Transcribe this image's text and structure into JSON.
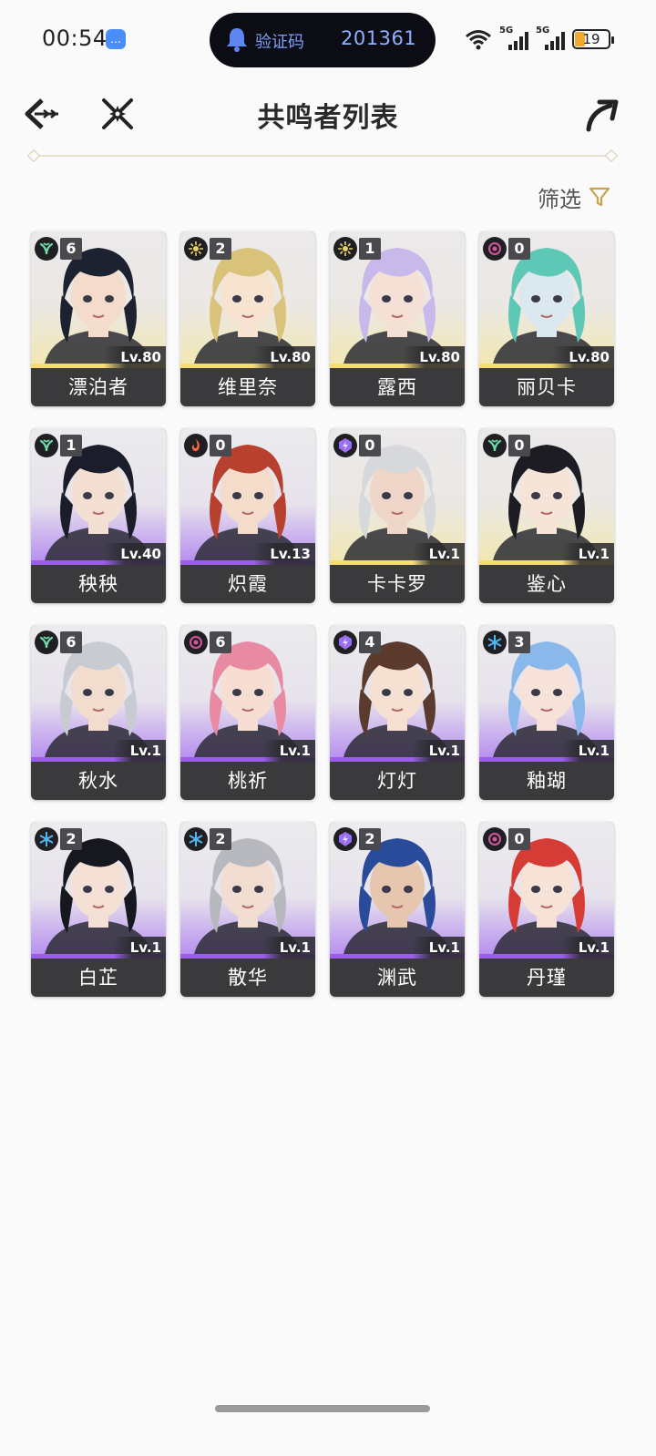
{
  "status_bar": {
    "time": "00:54",
    "pill_label": "验证码",
    "pill_code": "201361",
    "network_1": "5G",
    "network_2": "5G",
    "battery": "19"
  },
  "header": {
    "title": "共鸣者列表"
  },
  "filter": {
    "label": "筛选"
  },
  "colors": {
    "accent_gold": "#c7a34a",
    "title_text": "#2a2a2a",
    "card_name_bar": "#3a3a3c",
    "rarity_gold": "#f6dc74",
    "rarity_purple": "#9a5ee8"
  },
  "characters": [
    {
      "name": "漂泊者",
      "level": "Lv.80",
      "sequence": "6",
      "attribute_icon": "aero-icon",
      "rarity": "gold",
      "hair": "#1d2230",
      "skin": "#f3dccb"
    },
    {
      "name": "维里奈",
      "level": "Lv.80",
      "sequence": "2",
      "attribute_icon": "spectro-icon",
      "rarity": "gold",
      "hair": "#d9c37a",
      "skin": "#f7e4d0"
    },
    {
      "name": "露西",
      "level": "Lv.80",
      "sequence": "1",
      "attribute_icon": "spectro-icon",
      "rarity": "gold",
      "hair": "#c9b9ea",
      "skin": "#f5e0d6"
    },
    {
      "name": "丽贝卡",
      "level": "Lv.80",
      "sequence": "0",
      "attribute_icon": "havoc-icon",
      "rarity": "gold",
      "hair": "#5ec8b6",
      "skin": "#dce8f0"
    },
    {
      "name": "秧秧",
      "level": "Lv.40",
      "sequence": "1",
      "attribute_icon": "aero-icon",
      "rarity": "purple",
      "hair": "#1b1d2a",
      "skin": "#f4e0d2"
    },
    {
      "name": "炽霞",
      "level": "Lv.13",
      "sequence": "0",
      "attribute_icon": "fusion-icon",
      "rarity": "purple",
      "hair": "#b8402e",
      "skin": "#f5dcca"
    },
    {
      "name": "卡卡罗",
      "level": "Lv.1",
      "sequence": "0",
      "attribute_icon": "electro-icon",
      "rarity": "gold",
      "hair": "#d6d8db",
      "skin": "#eed6c8"
    },
    {
      "name": "鉴心",
      "level": "Lv.1",
      "sequence": "0",
      "attribute_icon": "aero-icon",
      "rarity": "gold",
      "hair": "#1c1c22",
      "skin": "#f6e4d8"
    },
    {
      "name": "秋水",
      "level": "Lv.1",
      "sequence": "6",
      "attribute_icon": "aero-icon",
      "rarity": "purple",
      "hair": "#c8ccd2",
      "skin": "#f2dccd"
    },
    {
      "name": "桃祈",
      "level": "Lv.1",
      "sequence": "6",
      "attribute_icon": "havoc-icon",
      "rarity": "purple",
      "hair": "#e88aa2",
      "skin": "#f6dfd2"
    },
    {
      "name": "灯灯",
      "level": "Lv.1",
      "sequence": "4",
      "attribute_icon": "electro-icon",
      "rarity": "purple",
      "hair": "#5a3b2e",
      "skin": "#f6e0d2"
    },
    {
      "name": "釉瑚",
      "level": "Lv.1",
      "sequence": "3",
      "attribute_icon": "glacio-icon",
      "rarity": "purple",
      "hair": "#8ab8ea",
      "skin": "#f6e2d8"
    },
    {
      "name": "白芷",
      "level": "Lv.1",
      "sequence": "2",
      "attribute_icon": "glacio-icon",
      "rarity": "purple",
      "hair": "#17181f",
      "skin": "#f4e0d4"
    },
    {
      "name": "散华",
      "level": "Lv.1",
      "sequence": "2",
      "attribute_icon": "glacio-icon",
      "rarity": "purple",
      "hair": "#b8b8bf",
      "skin": "#f1ddd2"
    },
    {
      "name": "渊武",
      "level": "Lv.1",
      "sequence": "2",
      "attribute_icon": "electro-icon",
      "rarity": "purple",
      "hair": "#2a4a9a",
      "skin": "#e6c6ae"
    },
    {
      "name": "丹瑾",
      "level": "Lv.1",
      "sequence": "0",
      "attribute_icon": "havoc-icon",
      "rarity": "purple",
      "hair": "#d63c36",
      "skin": "#f6e2d6"
    }
  ]
}
